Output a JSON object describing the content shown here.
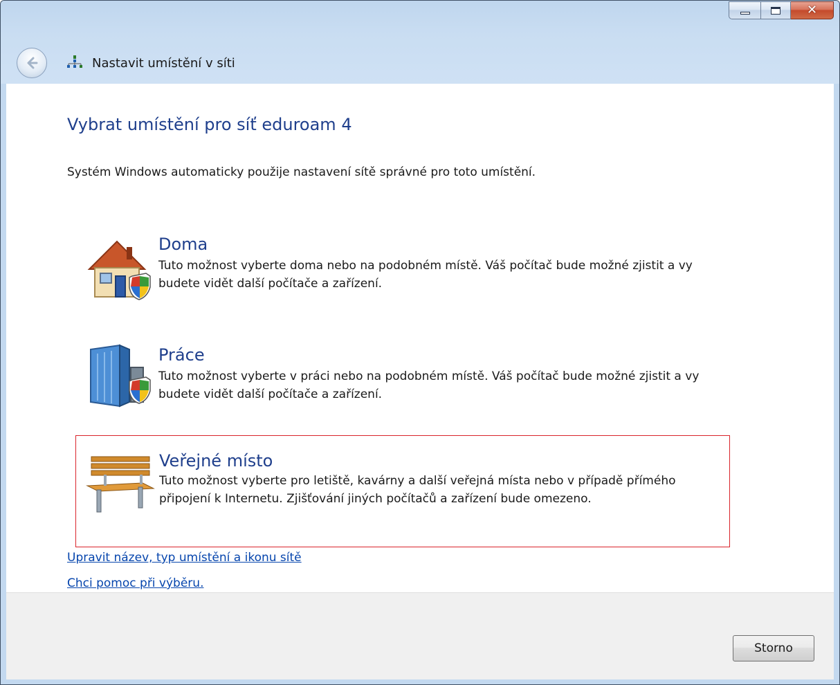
{
  "window": {
    "nav_title": "Nastavit umístění v síti"
  },
  "main": {
    "heading": "Vybrat umístění pro síť eduroam  4",
    "description": "Systém Windows automaticky použije nastavení sítě správné pro toto umístění."
  },
  "options": [
    {
      "title": "Doma",
      "description": "Tuto možnost vyberte doma nebo na podobném místě. Váš počítač bude možné zjistit a vy budete vidět další počítače a zařízení.",
      "icon": "house-shield-icon"
    },
    {
      "title": "Práce",
      "description": "Tuto možnost vyberte v práci nebo na podobném místě. Váš počítač bude možné zjistit a vy budete vidět další počítače a zařízení.",
      "icon": "office-building-shield-icon"
    },
    {
      "title": "Veřejné místo",
      "description": "Tuto možnost vyberte pro letiště, kavárny a další veřejná místa nebo v případě přímého připojení k Internetu. Zjišťování jiných počítačů a zařízení bude omezeno.",
      "icon": "park-bench-icon",
      "highlighted": true,
      "highlight_color": "#d9232a"
    }
  ],
  "links": {
    "customize": "Upravit název, typ umístění a ikonu sítě",
    "help": "Chci pomoc při výběru."
  },
  "footer": {
    "cancel_label": "Storno"
  },
  "colors": {
    "heading": "#1f3f8c",
    "link": "#0645ad",
    "titlebar": "#c3d9f0",
    "footer": "#f0f0f0"
  }
}
